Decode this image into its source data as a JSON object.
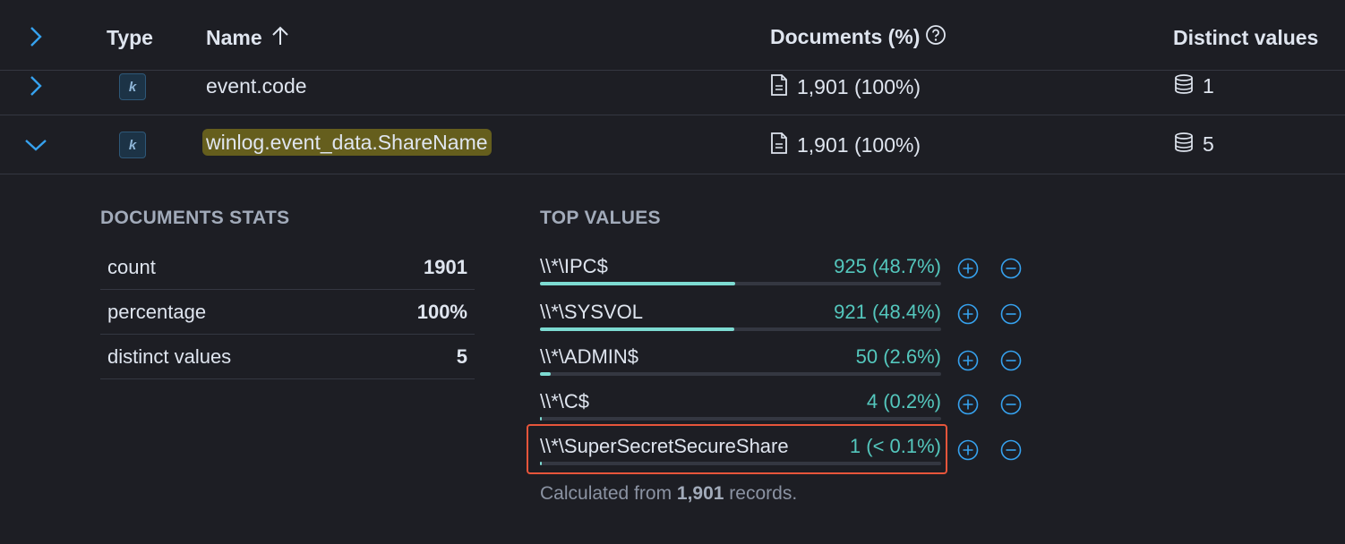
{
  "header": {
    "type_label": "Type",
    "name_label": "Name",
    "sort_icon": "arrow-up-icon",
    "documents_label": "Documents (%)",
    "help_icon": "question-circle-icon",
    "distinct_label": "Distinct values"
  },
  "rows": [
    {
      "expand_icon": "chevron-right-icon",
      "type": "k",
      "name": "event.code",
      "documents": "1,901 (100%)",
      "documents_icon": "document-icon",
      "distinct": "1",
      "distinct_icon": "database-icon"
    },
    {
      "expand_icon": "chevron-down-icon",
      "type": "k",
      "name": "winlog.event_data.ShareName",
      "documents": "1,901 (100%)",
      "documents_icon": "document-icon",
      "distinct": "5",
      "distinct_icon": "database-icon"
    }
  ],
  "doc_stats": {
    "title": "DOCUMENTS STATS",
    "items": [
      {
        "label": "count",
        "value": "1901"
      },
      {
        "label": "percentage",
        "value": "100%"
      },
      {
        "label": "distinct values",
        "value": "5"
      }
    ]
  },
  "top_values": {
    "title": "TOP VALUES",
    "items": [
      {
        "label": "\\\\*\\IPC$",
        "count": "925 (48.7%)",
        "fraction": 0.487
      },
      {
        "label": "\\\\*\\SYSVOL",
        "count": "921 (48.4%)",
        "fraction": 0.484
      },
      {
        "label": "\\\\*\\ADMIN$",
        "count": "50 (2.6%)",
        "fraction": 0.026
      },
      {
        "label": "\\\\*\\C$",
        "count": "4 (0.2%)",
        "fraction": 0.002
      },
      {
        "label": "\\\\*\\SuperSecretSecureShare",
        "count": "1 (< 0.1%)",
        "fraction": 0.001
      }
    ],
    "plus_icon": "plus-circle-icon",
    "minus_icon": "minus-circle-icon",
    "footer_prefix": "Calculated from ",
    "footer_count": "1,901",
    "footer_suffix": " records."
  },
  "colors": {
    "background": "#1d1e24",
    "accent": "#54c7bd",
    "link": "#36a2ef",
    "highlight": "#655e1d",
    "annotation_box": "#e7553b"
  }
}
